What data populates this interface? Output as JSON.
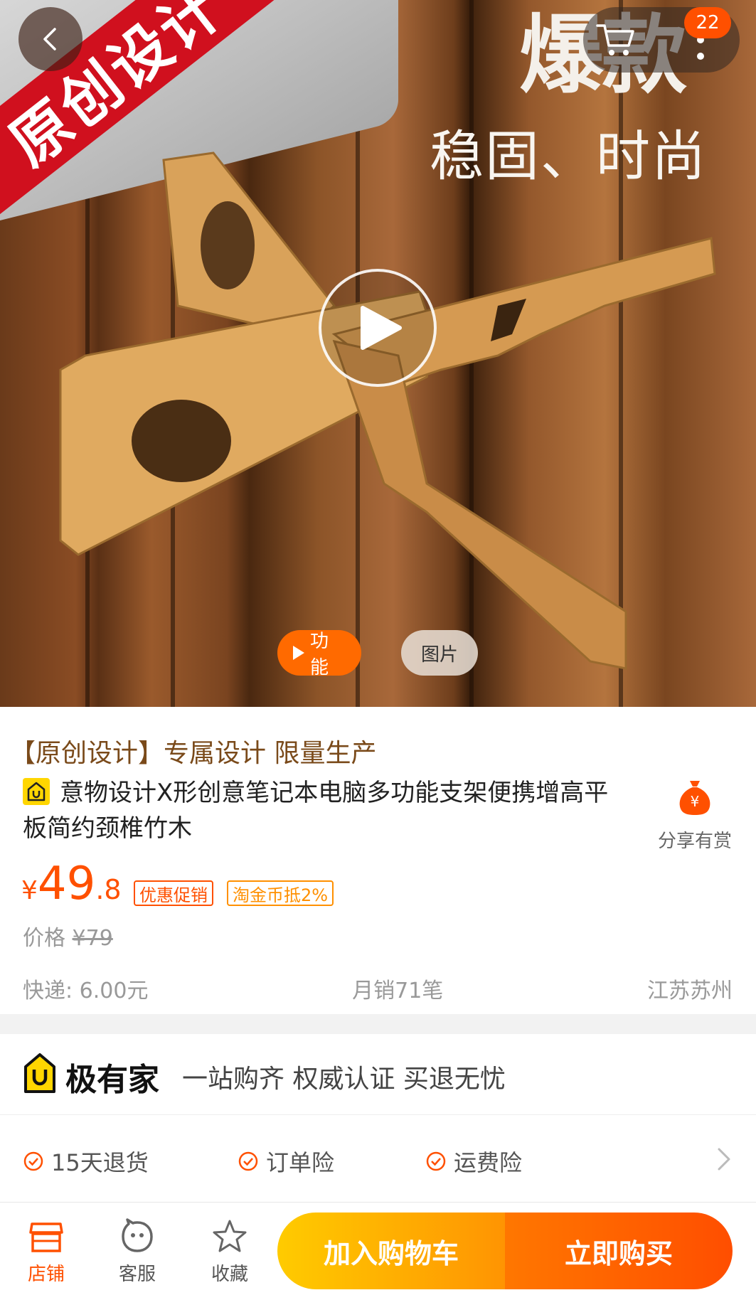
{
  "hero": {
    "banner_text": "原创设计",
    "big_text": "爆款",
    "sub_text": "稳固、时尚",
    "cart_badge": "22",
    "media_tabs": [
      {
        "label": "功能",
        "active": true
      },
      {
        "label": "图片",
        "active": false
      }
    ]
  },
  "product": {
    "tagline": "【原创设计】专属设计 限量生产",
    "title": "意物设计X形创意笔记本电脑多功能支架便携增高平板简约颈椎竹木",
    "share_label": "分享有赏",
    "price_symbol": "¥",
    "price_int": "49",
    "price_dec": ".8",
    "promo_tags": [
      "优惠促销",
      "淘金币抵2%"
    ],
    "orig_price_label": "价格",
    "orig_price_value": "¥79",
    "shipping": "快递: 6.00元",
    "monthly_sales": "月销71笔",
    "location": "江苏苏州"
  },
  "jiyoujia": {
    "name": "极有家",
    "slogan": "一站购齐 权威认证 买退无忧"
  },
  "guarantees": [
    "15天退货",
    "订单险",
    "运费险"
  ],
  "bottom_bar": {
    "shop": "店铺",
    "service": "客服",
    "favorite": "收藏",
    "add_to_cart": "加入购物车",
    "buy_now": "立即购买"
  },
  "colors": {
    "accent": "#ff5000",
    "cart_gradient_start": "#ffcb00",
    "buy_gradient_end": "#ff4e00",
    "banner_red": "#d0101e"
  }
}
